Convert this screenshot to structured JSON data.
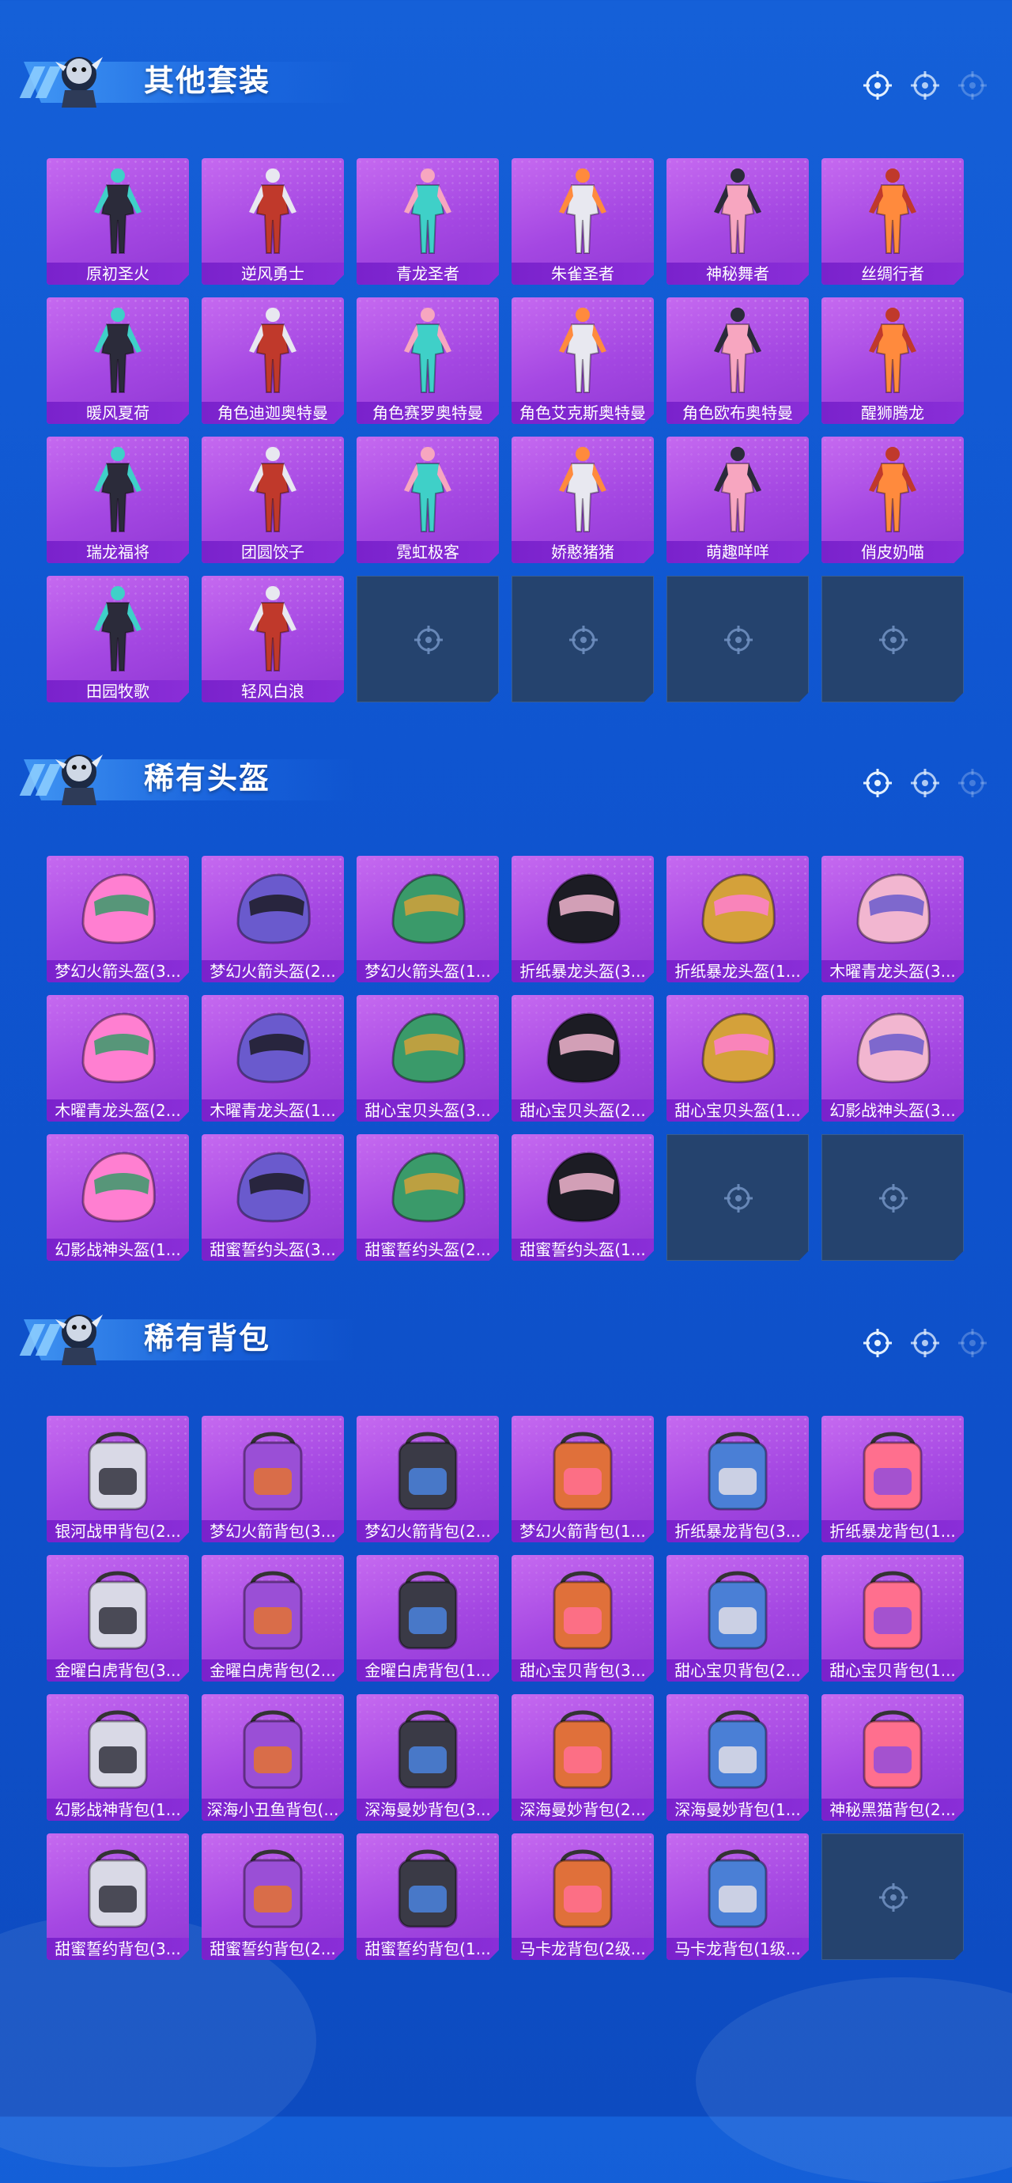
{
  "sections": [
    {
      "title": "其他套装",
      "items": [
        "原初圣火",
        "逆风勇士",
        "青龙圣者",
        "朱雀圣者",
        "神秘舞者",
        "丝绸行者",
        "暖风夏荷",
        "角色迪迦奥特曼",
        "角色赛罗奥特曼",
        "角色艾克斯奥特曼",
        "角色欧布奥特曼",
        "醒狮腾龙",
        "瑞龙福将",
        "团圆饺子",
        "霓虹极客",
        "娇憨猪猪",
        "萌趣咩咩",
        "俏皮奶喵",
        "田园牧歌",
        "轻风白浪"
      ]
    },
    {
      "title": "稀有头盔",
      "items": [
        "梦幻火箭头盔(3...",
        "梦幻火箭头盔(2...",
        "梦幻火箭头盔(1...",
        "折纸暴龙头盔(3...",
        "折纸暴龙头盔(1...",
        "木曜青龙头盔(3...",
        "木曜青龙头盔(2...",
        "木曜青龙头盔(1...",
        "甜心宝贝头盔(3...",
        "甜心宝贝头盔(2...",
        "甜心宝贝头盔(1...",
        "幻影战神头盔(3...",
        "幻影战神头盔(1...",
        "甜蜜誓约头盔(3...",
        "甜蜜誓约头盔(2...",
        "甜蜜誓约头盔(1..."
      ]
    },
    {
      "title": "稀有背包",
      "items": [
        "银河战甲背包(2...",
        "梦幻火箭背包(3...",
        "梦幻火箭背包(2...",
        "梦幻火箭背包(1...",
        "折纸暴龙背包(3...",
        "折纸暴龙背包(1...",
        "金曜白虎背包(3...",
        "金曜白虎背包(2...",
        "金曜白虎背包(1...",
        "甜心宝贝背包(3...",
        "甜心宝贝背包(2...",
        "甜心宝贝背包(1...",
        "幻影战神背包(1...",
        "深海小丑鱼背包(...",
        "深海曼妙背包(3...",
        "深海曼妙背包(2...",
        "深海曼妙背包(1...",
        "神秘黑猫背包(2...",
        "甜蜜誓约背包(3...",
        "甜蜜誓约背包(2...",
        "甜蜜誓约背包(1...",
        "马卡龙背包(2级...",
        "马卡龙背包(1级..."
      ]
    }
  ]
}
